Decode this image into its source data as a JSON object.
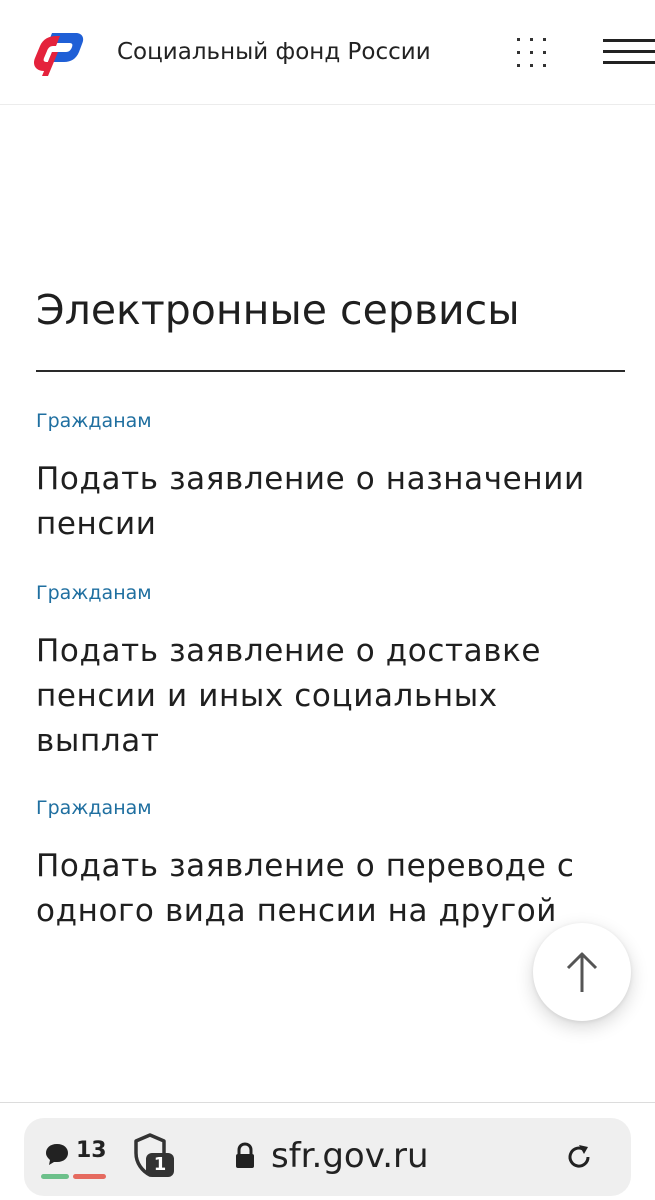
{
  "header": {
    "site_title": "Социальный фонд России",
    "logo_icon": "sfr-logo-icon",
    "apps_icon": "apps-grid-icon",
    "menu_icon": "hamburger-menu-icon"
  },
  "main": {
    "section_title": "Электронные сервисы",
    "services": [
      {
        "category": "Гражданам",
        "title": "Подать заявление о назначении пенсии"
      },
      {
        "category": "Гражданам",
        "title": "Подать заявление о доставке пенсии и иных социальных выплат"
      },
      {
        "category": "Гражданам",
        "title": "Подать заявление о переводе с одного вида пенсии на другой"
      }
    ],
    "scroll_top_icon": "arrow-up-icon"
  },
  "browser": {
    "chat_count": "13",
    "shield_count": "1",
    "url": "sfr.gov.ru",
    "icons": [
      "chat-bubble-icon",
      "shield-icon",
      "lock-icon",
      "reload-icon"
    ]
  },
  "colors": {
    "link_blue": "#1f6fa0",
    "logo_blue": "#1f5fd6",
    "logo_red": "#e4223c",
    "indicator_green": "#6cc08a",
    "indicator_red": "#e56a5f"
  }
}
